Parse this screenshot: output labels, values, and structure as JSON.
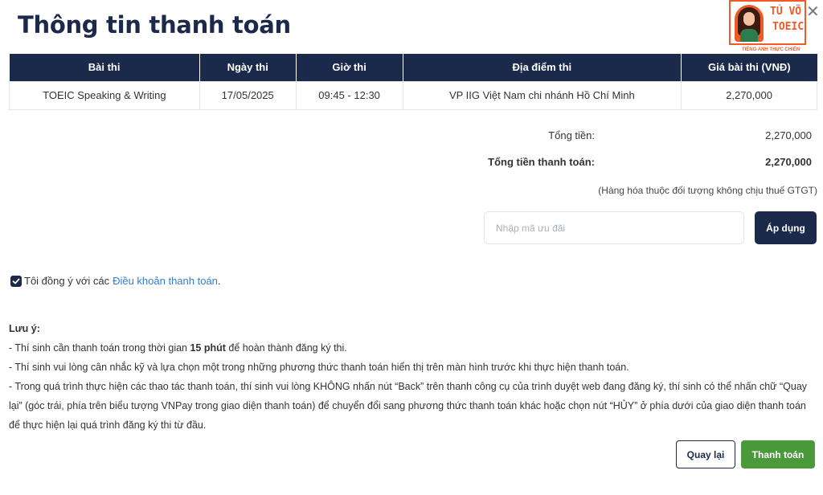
{
  "title": "Thông tin thanh toán",
  "logo": {
    "line1": "TÚ VÕ",
    "line2": "TOEIC",
    "tagline": "TIẾNG ANH THỰC CHIẾN"
  },
  "close_glyph": "✕",
  "table": {
    "headers": [
      "Bài thi",
      "Ngày thi",
      "Giờ thi",
      "Địa điểm thi",
      "Giá bài thi (VNĐ)"
    ],
    "rows": [
      [
        "TOEIC Speaking & Writing",
        "17/05/2025",
        "09:45 - 12:30",
        "VP IIG Việt Nam chi nhánh Hồ Chí Minh",
        "2,270,000"
      ]
    ]
  },
  "summary": {
    "total_label": "Tổng tiền:",
    "total_value": "2,270,000",
    "pay_total_label": "Tổng tiền thanh toán:",
    "pay_total_value": "2,270,000",
    "vat_note": "(Hàng hóa thuộc đối tượng không chịu thuế GTGT)"
  },
  "promo": {
    "placeholder": "Nhập mã ưu đãi",
    "apply_label": "Áp dụng"
  },
  "agree": {
    "text": "Tôi đồng ý với các",
    "link": "Điều khoản thanh toán",
    "end": "."
  },
  "notes": {
    "heading": "Lưu ý:",
    "line1_pre": "- Thí sinh cần thanh toán trong thời gian ",
    "line1_bold": "15 phút",
    "line1_post": " để hoàn thành đăng ký thi.",
    "line2": "- Thí sinh vui lòng cân nhắc kỹ và lựa chọn một trong những phương thức thanh toán hiển thị trên màn hình trước khi thực hiện thanh toán.",
    "line3": "- Trong quá trình thực hiện các thao tác thanh toán, thí sinh vui lòng KHÔNG nhấn nút “Back” trên thanh công cụ của trình duyệt web đang đăng ký, thí sinh có thể nhấn chữ “Quay lại” (góc trái, phía trên biểu tượng VNPay trong giao diện thanh toán) để chuyển đổi sang phương thức thanh toán khác hoặc chọn nút “HỦY” ở phía dưới của giao diện thanh toán để thực hiện lại quá trình đăng ký thi từ đầu."
  },
  "buttons": {
    "back": "Quay lại",
    "pay": "Thanh toán"
  },
  "colors": {
    "navy": "#1b2a4a",
    "green": "#4a9a3c",
    "link": "#2f7dd3",
    "brand_orange": "#f05a28"
  }
}
